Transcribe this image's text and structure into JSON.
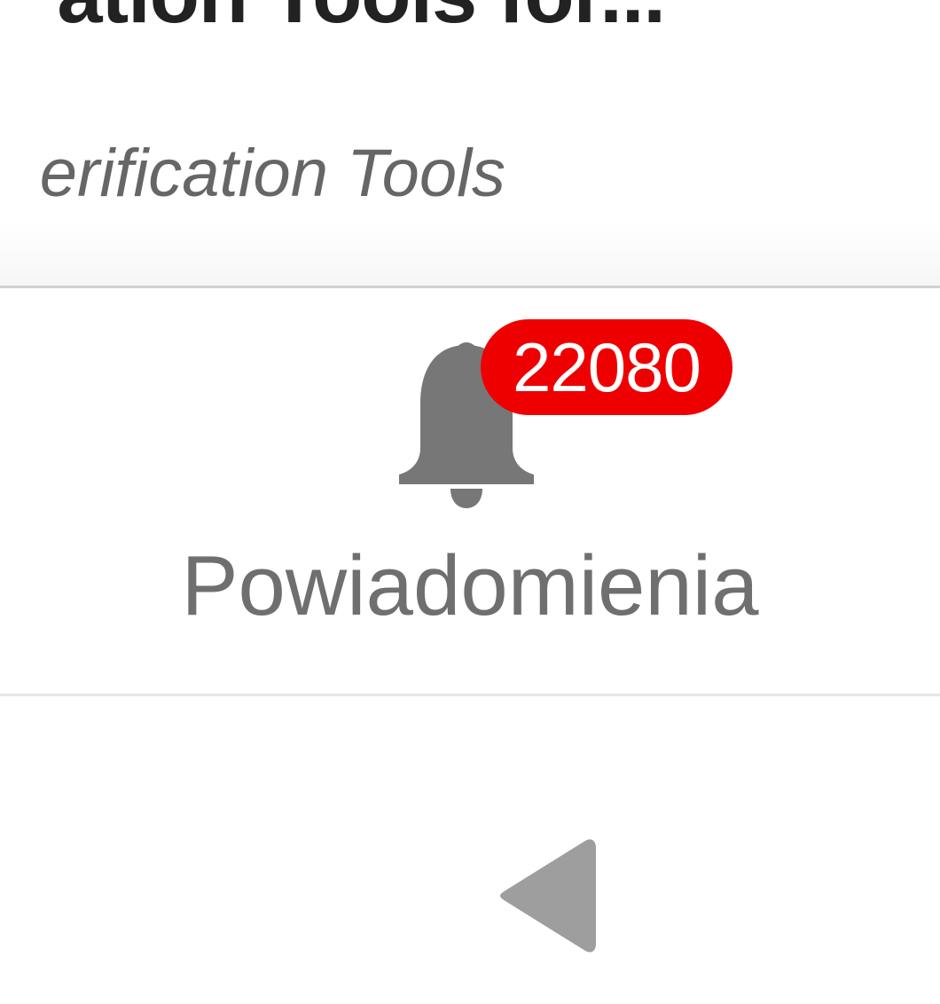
{
  "header": {
    "title": "ation Tools for...",
    "subtitle": "erification Tools"
  },
  "notifications": {
    "icon": "bell-icon",
    "badge_count": "22080",
    "label": "Powiadomienia",
    "badge_color": "#ee0000",
    "icon_color": "#777777"
  },
  "bottom_nav": {
    "back_icon": "back-triangle-icon",
    "icon_color": "#9e9e9e"
  }
}
